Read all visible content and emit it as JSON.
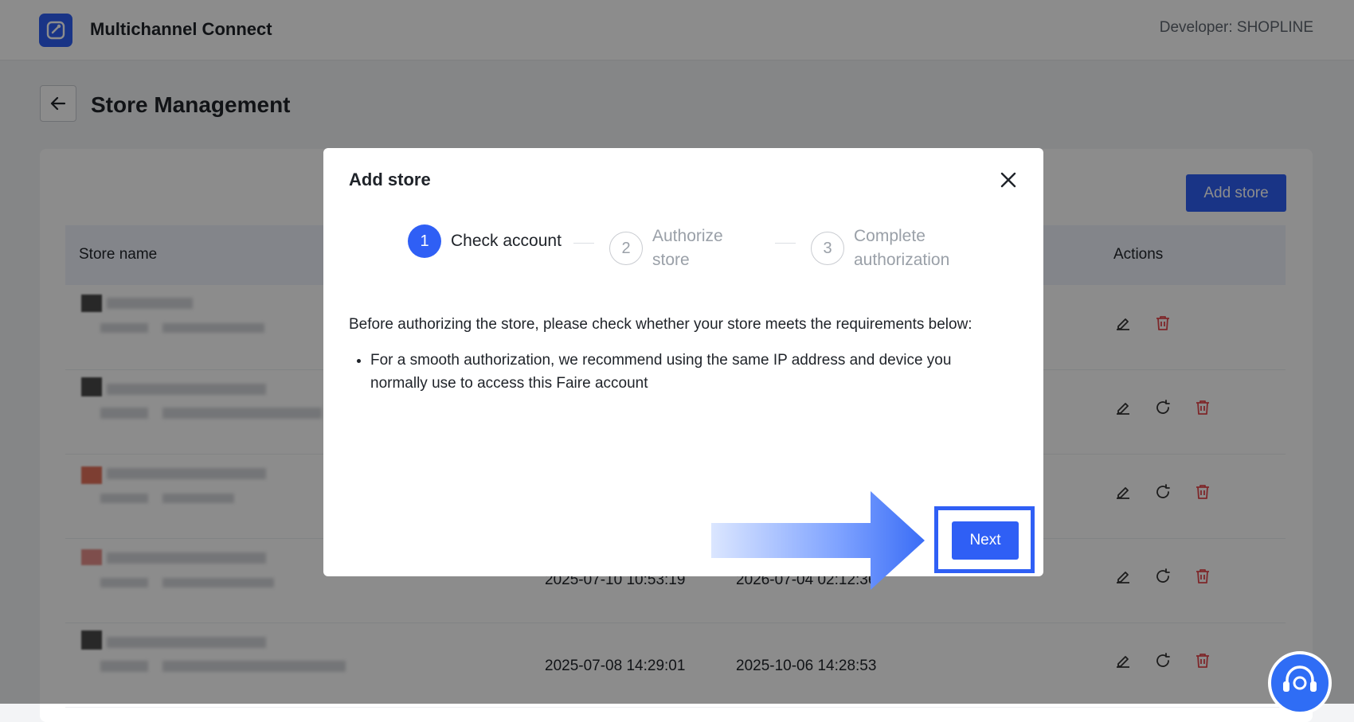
{
  "app": {
    "title": "Multichannel Connect",
    "developer": "Developer: SHOPLINE"
  },
  "page": {
    "title": "Store Management",
    "add_store_label": "Add store"
  },
  "table": {
    "columns": [
      "Store name",
      "Actions"
    ],
    "rows": [
      {
        "created": "",
        "expires": "",
        "actions": [
          "pencil-icon",
          "trash-icon"
        ]
      },
      {
        "created": "",
        "expires": "",
        "actions": [
          "pencil-icon",
          "refresh-icon",
          "trash-icon"
        ]
      },
      {
        "created": "",
        "expires": "",
        "actions": [
          "pencil-icon",
          "refresh-icon",
          "trash-icon"
        ]
      },
      {
        "created": "2025-07-10 10:53:19",
        "expires": "2026-07-04 02:12:36",
        "actions": [
          "pencil-icon",
          "refresh-icon",
          "trash-icon"
        ]
      },
      {
        "created": "2025-07-08 14:29:01",
        "expires": "2025-10-06 14:28:53",
        "actions": [
          "pencil-icon",
          "refresh-icon",
          "trash-icon"
        ]
      }
    ]
  },
  "modal": {
    "title": "Add store",
    "steps": [
      {
        "number": "1",
        "label": "Check account",
        "state": "active"
      },
      {
        "number": "2",
        "label": "Authorize store",
        "state": "todo"
      },
      {
        "number": "3",
        "label": "Complete authorization",
        "state": "todo"
      }
    ],
    "intro": "Before authorizing the store, please check whether your store meets the requirements below:",
    "requirements": [
      "For a smooth authorization, we recommend using the same IP address and device you normally use to access this Faire account"
    ],
    "next_label": "Next"
  },
  "colors": {
    "accent": "#2f5ff5",
    "danger": "#e5484d",
    "overlay": "rgba(0,0,0,0.45)"
  }
}
